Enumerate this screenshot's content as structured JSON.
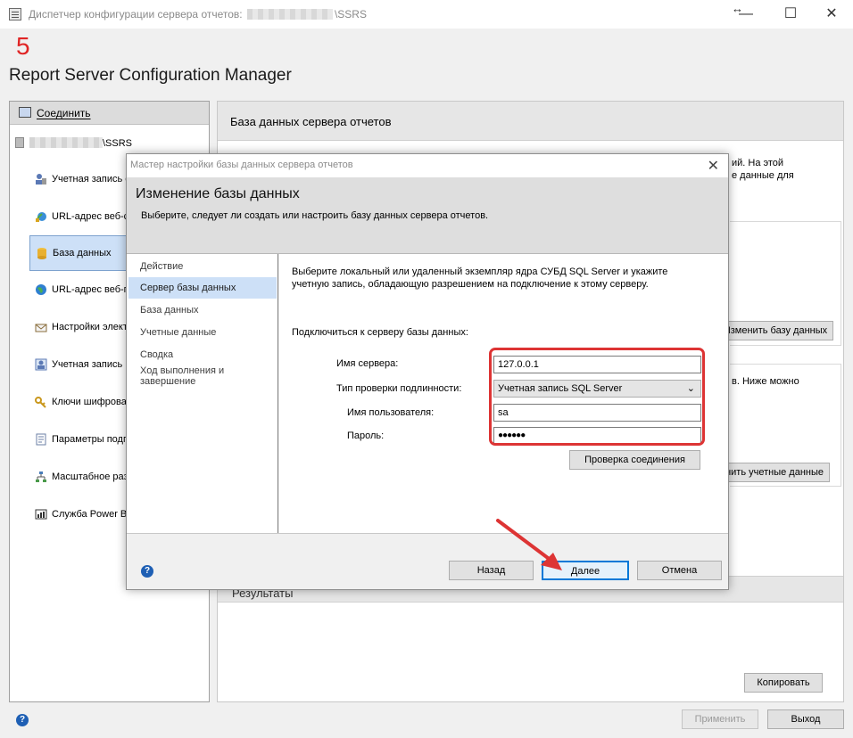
{
  "window": {
    "title_prefix": "Диспетчер конфигурации сервера отчетов:",
    "title_suffix": "\\SSRS",
    "controls": {
      "resize": "↔",
      "minimize": "—",
      "maximize": "☐",
      "close": "✕"
    }
  },
  "annotation": {
    "step_number": "5"
  },
  "header": {
    "app_title": "Report Server Configuration Manager"
  },
  "sidebar": {
    "connect_label": "Соединить",
    "server_suffix": "\\SSRS",
    "items": [
      {
        "label": "Учетная запись служб",
        "icon": "service-account-icon"
      },
      {
        "label": "URL-адрес веб-службы",
        "icon": "web-url-icon"
      },
      {
        "label": "База данных",
        "icon": "database-icon"
      },
      {
        "label": "URL-адрес веб-портала",
        "icon": "globe-icon"
      },
      {
        "label": "Настройки электронной почты",
        "icon": "email-icon"
      },
      {
        "label": "Учетная запись выполнения",
        "icon": "execution-account-icon"
      },
      {
        "label": "Ключи шифрования",
        "icon": "key-icon"
      },
      {
        "label": "Параметры подписки",
        "icon": "subscription-icon"
      },
      {
        "label": "Масштабное развертывание",
        "icon": "scaleout-icon"
      },
      {
        "label": "Служба Power BI",
        "icon": "powerbi-icon"
      }
    ]
  },
  "main": {
    "heading": "База данных сервера отчетов",
    "desc_line1": "ий. На этой",
    "desc_line2": "е данные для",
    "change_db_button": "Изменить базу данных",
    "box2_text": "в. Ниже можно",
    "change_creds_button": "нить учетные данные",
    "results_heading": "Результаты",
    "copy_button": "Копировать"
  },
  "footer": {
    "apply_button": "Применить",
    "exit_button": "Выход"
  },
  "dialog": {
    "title": "Мастер настройки базы данных сервера отчетов",
    "heading": "Изменение базы данных",
    "subheading": "Выберите, следует ли создать или настроить базу данных сервера отчетов.",
    "steps": [
      "Действие",
      "Сервер базы данных",
      "База данных",
      "Учетные данные",
      "Сводка",
      "Ход выполнения и завершение"
    ],
    "intro": "Выберите локальный или удаленный экземпляр ядра СУБД SQL Server и укажите учетную запись, обладающую разрешением на подключение к этому серверу.",
    "connect_label": "Подключиться к серверу базы данных:",
    "server_name_label": "Имя сервера:",
    "server_name_value": "127.0.0.1",
    "auth_label": "Тип проверки подлинности:",
    "auth_value": "Учетная запись SQL Server",
    "username_label": "Имя пользователя:",
    "username_value": "sa",
    "password_label": "Пароль:",
    "password_value": "●●●●●●",
    "test_button": "Проверка соединения",
    "back_button": "Назад",
    "next_button": "Далее",
    "cancel_button": "Отмена"
  },
  "colors": {
    "highlight_red": "#dd3434",
    "selection_blue": "#cde0f7",
    "focus_blue": "#0078d7"
  }
}
